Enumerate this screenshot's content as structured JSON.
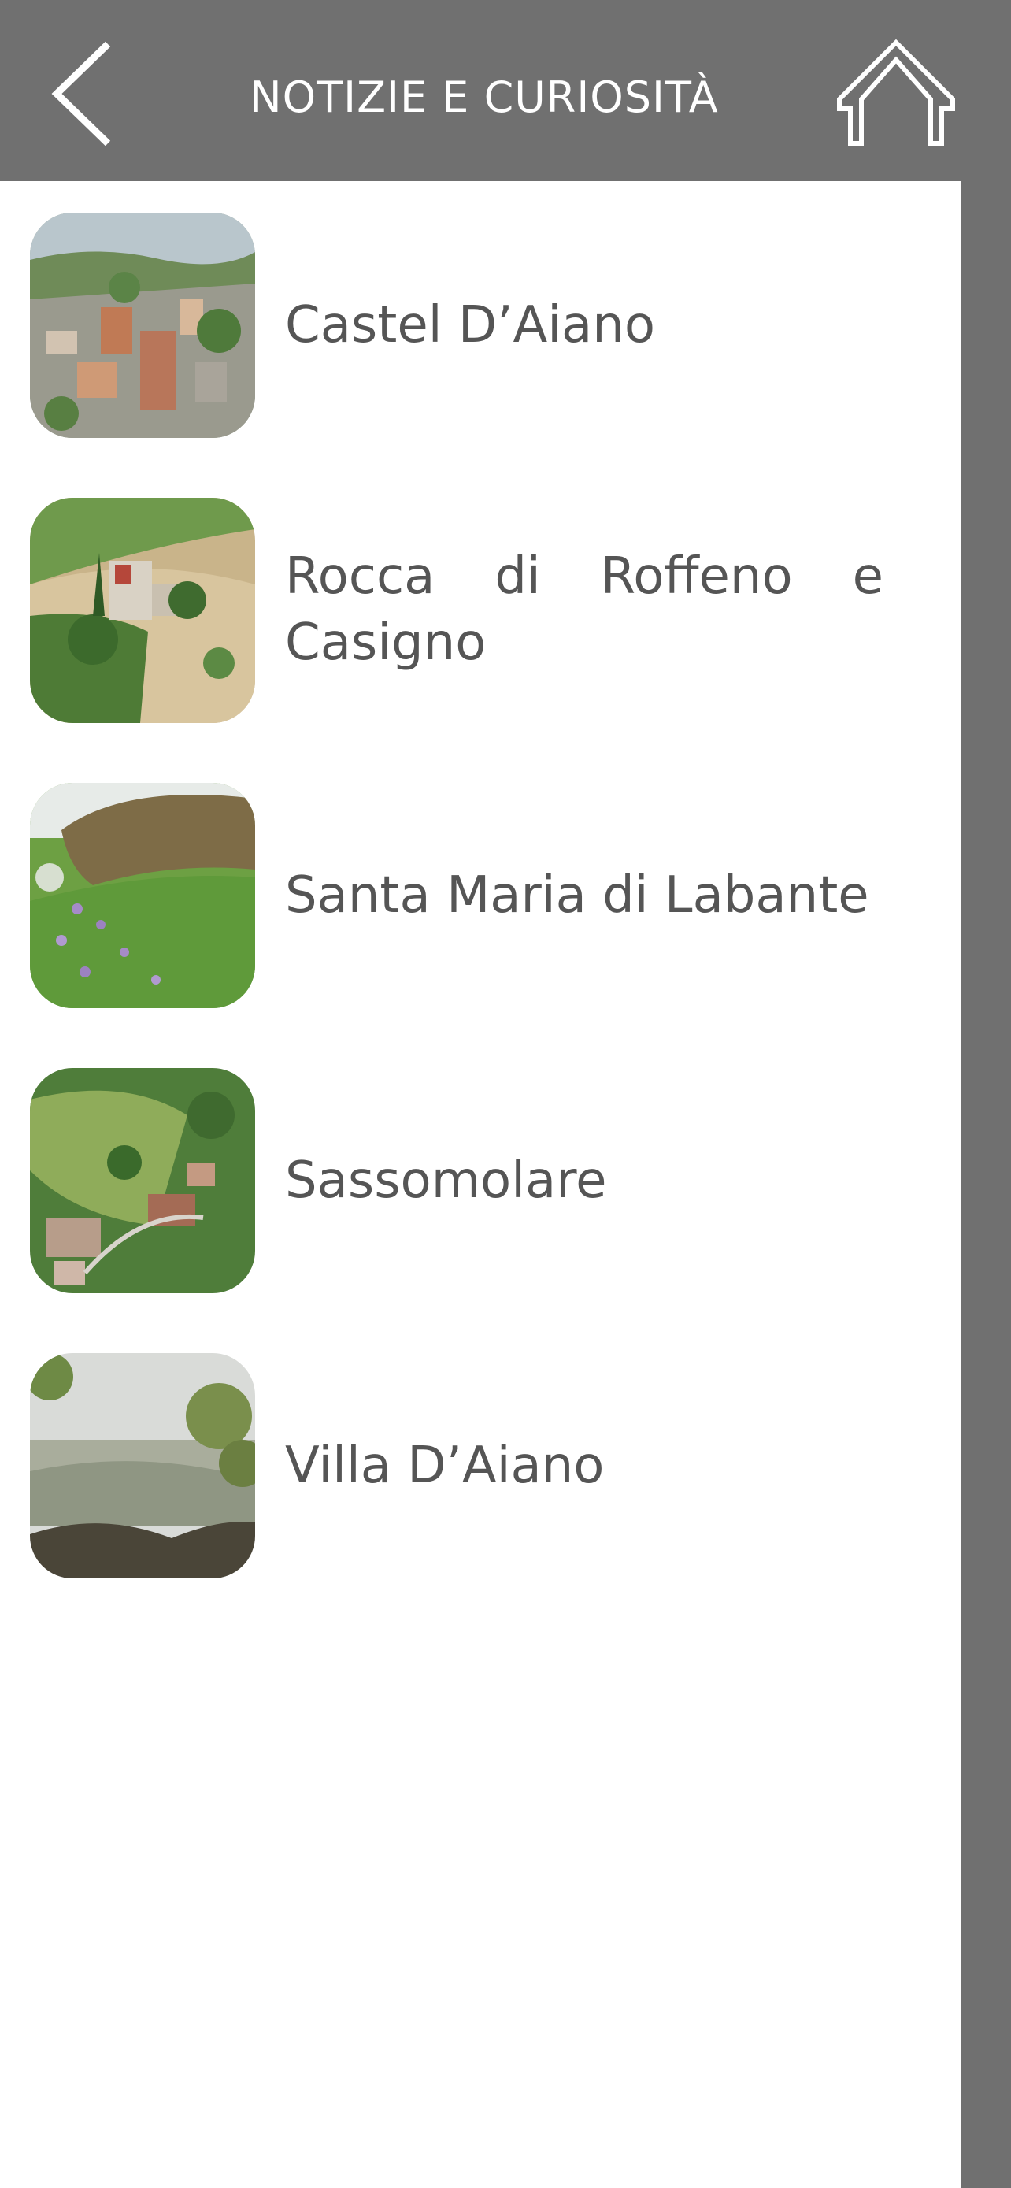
{
  "header": {
    "title": "NOTIZIE E CURIOSITÀ",
    "back_icon": "chevron-left-icon",
    "home_icon": "home-icon",
    "background_color": "#707070",
    "text_color": "#ffffff"
  },
  "list": {
    "text_color": "#555555",
    "items": [
      {
        "label": "Castel D’Aiano",
        "image": "village-aerial-photo"
      },
      {
        "label": "Rocca di Roffeno e Casigno",
        "image": "church-hill-photo"
      },
      {
        "label": "Santa Maria di Labante",
        "image": "meadow-rock-photo"
      },
      {
        "label": "Sassomolare",
        "image": "valley-houses-photo"
      },
      {
        "label": "Villa D’Aiano",
        "image": "misty-valley-photo"
      }
    ]
  }
}
